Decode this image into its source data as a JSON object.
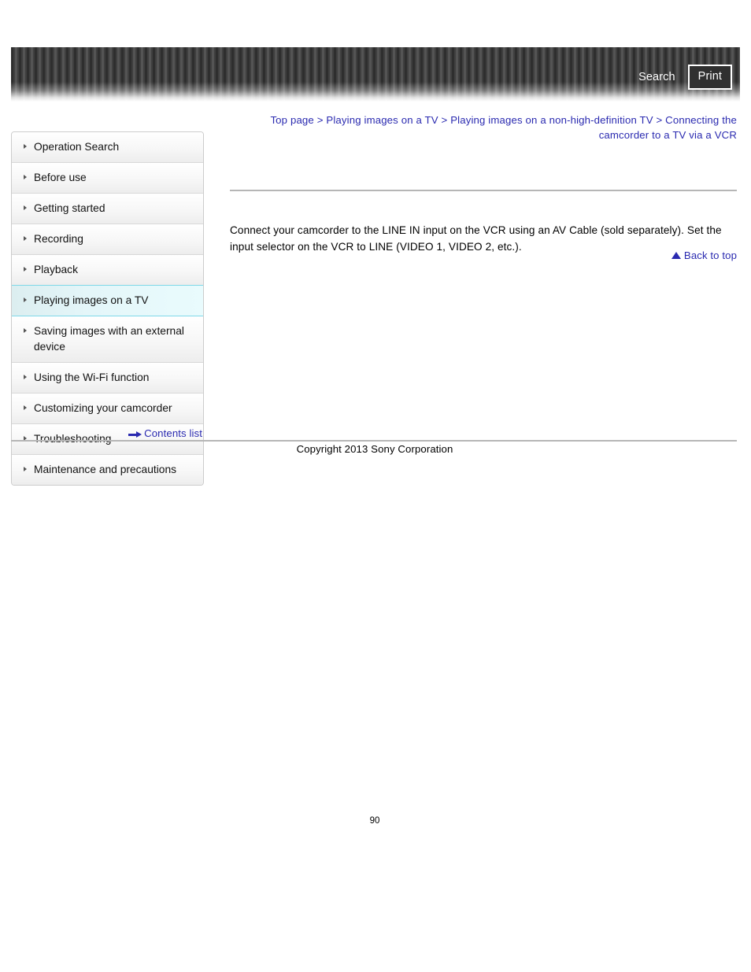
{
  "header": {
    "search_label": "Search",
    "print_label": "Print"
  },
  "breadcrumb": {
    "text": "Top page > Playing images on a TV > Playing images on a non-high-definition TV > Connecting the camcorder to a TV via a VCR"
  },
  "sidebar": {
    "items": [
      {
        "label": "Operation Search",
        "active": false
      },
      {
        "label": "Before use",
        "active": false
      },
      {
        "label": "Getting started",
        "active": false
      },
      {
        "label": "Recording",
        "active": false
      },
      {
        "label": "Playback",
        "active": false
      },
      {
        "label": "Playing images on a TV",
        "active": true
      },
      {
        "label": "Saving images with an external device",
        "active": false
      },
      {
        "label": "Using the Wi-Fi function",
        "active": false
      },
      {
        "label": "Customizing your camcorder",
        "active": false
      },
      {
        "label": "Troubleshooting",
        "active": false
      },
      {
        "label": "Maintenance and precautions",
        "active": false
      }
    ],
    "contents_list_label": "Contents list"
  },
  "main": {
    "body_text": "Connect your camcorder to the LINE IN input on the VCR using an AV Cable (sold separately). Set the input selector on the VCR to LINE (VIDEO 1, VIDEO 2, etc.).",
    "back_to_top_label": "Back to top"
  },
  "footer": {
    "copyright": "Copyright 2013 Sony Corporation",
    "page_number": "90"
  },
  "colors": {
    "link": "#2a2ab0",
    "active_nav_border": "#7fd8e8",
    "rule": "#b6b6b6",
    "header_dark": "#2e2e2e"
  }
}
